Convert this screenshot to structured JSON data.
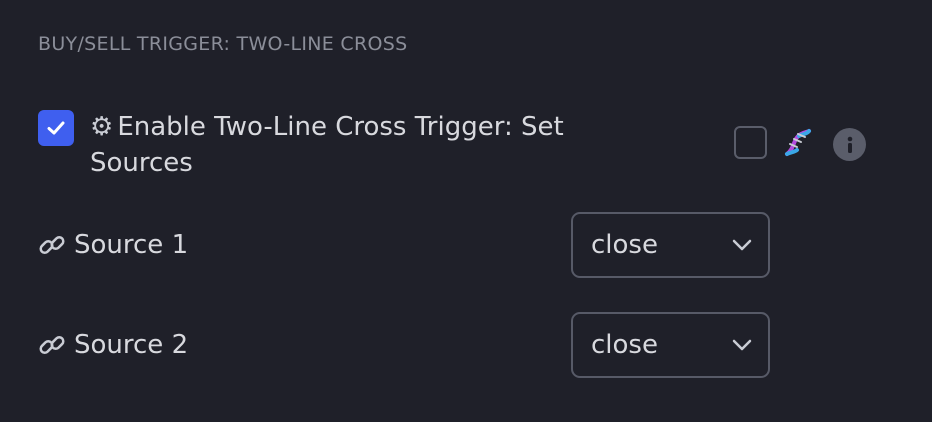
{
  "section": {
    "title": "BUY/SELL TRIGGER: TWO-LINE CROSS"
  },
  "enable_trigger": {
    "checked": true,
    "label": "Enable Two-Line Cross Trigger: Set Sources",
    "icon": "gear-icon"
  },
  "extras": {
    "secondary_checkbox_checked": false,
    "dna_icon": "dna-icon",
    "info_icon": "info-icon"
  },
  "sources": [
    {
      "label": "Source 1",
      "value": "close",
      "icon": "link-icon"
    },
    {
      "label": "Source 2",
      "value": "close",
      "icon": "link-icon"
    }
  ],
  "colors": {
    "background": "#1f2029",
    "accent": "#3f5fef",
    "muted_text": "#8b8e99",
    "text": "#d8d9de",
    "border": "#575a67"
  }
}
